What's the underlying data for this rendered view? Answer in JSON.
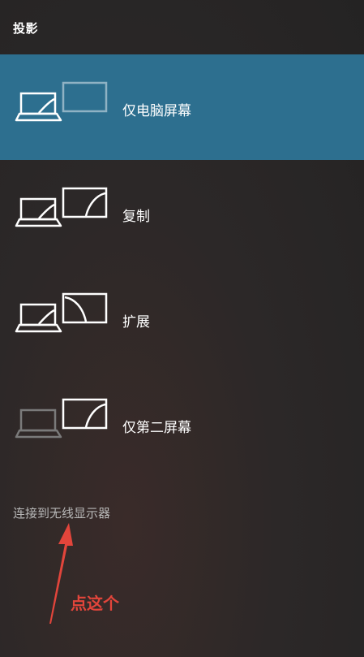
{
  "panel": {
    "title": "投影",
    "options": [
      {
        "label": "仅电脑屏幕",
        "icon": "pc-screen-only-icon",
        "selected": true
      },
      {
        "label": "复制",
        "icon": "duplicate-icon",
        "selected": false
      },
      {
        "label": "扩展",
        "icon": "extend-icon",
        "selected": false
      },
      {
        "label": "仅第二屏幕",
        "icon": "second-screen-only-icon",
        "selected": false
      }
    ],
    "wireless_link": "连接到无线显示器"
  },
  "annotation": {
    "text": "点这个",
    "color": "#e2453b"
  },
  "colors": {
    "selected_background": "#2d6f8f",
    "panel_background": "#2c2828",
    "text": "#ffffff",
    "muted_text": "#b8b8b8"
  }
}
